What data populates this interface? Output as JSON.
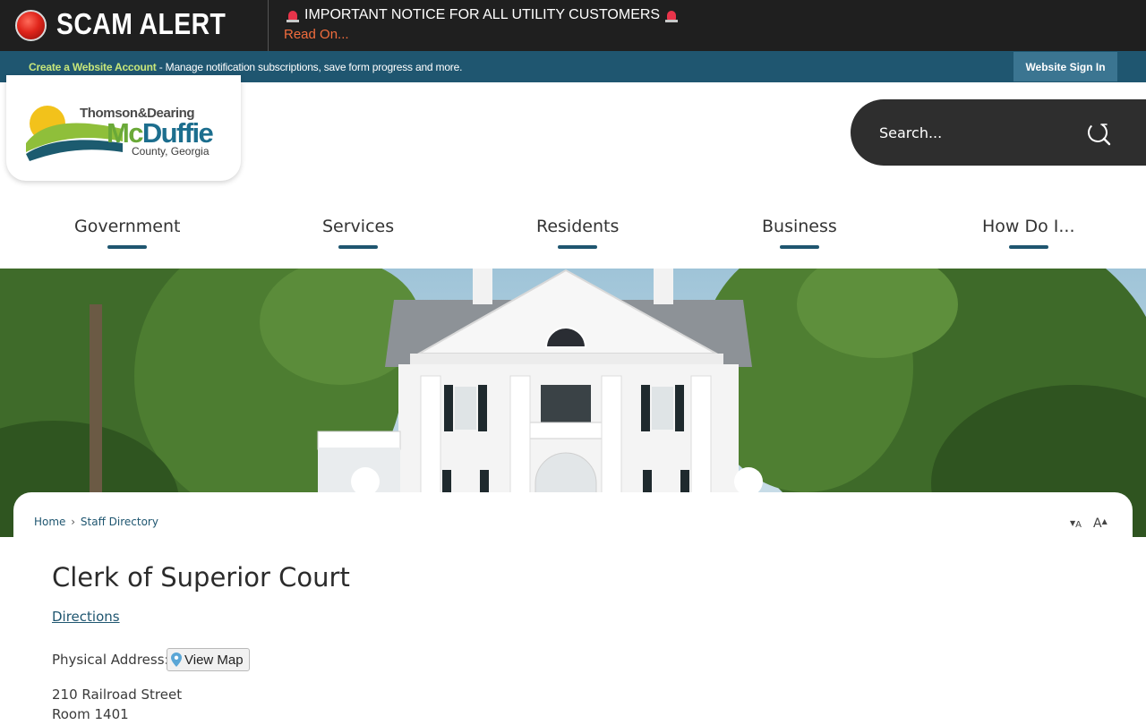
{
  "alert": {
    "title": "SCAM ALERT",
    "message": "IMPORTANT NOTICE FOR ALL UTILITY CUSTOMERS",
    "link": "Read On...",
    "icon": "siren-icon"
  },
  "account": {
    "create_link": "Create a Website Account",
    "description": " - Manage notification subscriptions, save form progress and more.",
    "sign_in": "Website Sign In"
  },
  "logo": {
    "line1": "Thomson&Dearing",
    "line2_mc": "Mc",
    "line2_rest": "Duffie",
    "line3": "County, Georgia"
  },
  "search": {
    "placeholder": "Search..."
  },
  "nav": {
    "items": [
      {
        "label": "Government"
      },
      {
        "label": "Services"
      },
      {
        "label": "Residents"
      },
      {
        "label": "Business"
      },
      {
        "label": "How Do I..."
      }
    ]
  },
  "breadcrumb": {
    "home": "Home",
    "separator": "›",
    "current": "Staff Directory"
  },
  "font_controls": {
    "decrease": "A",
    "increase": "A"
  },
  "page": {
    "title": "Clerk of Superior Court",
    "directions": "Directions",
    "address_label": "Physical Address:",
    "view_map": "View Map",
    "address_lines": [
      "210 Railroad Street",
      "Room 1401"
    ]
  },
  "colors": {
    "alert_bg": "#1f1f1f",
    "accent_teal": "#1f5670",
    "link_green": "#c7e67a",
    "alert_link": "#f26d3d"
  }
}
